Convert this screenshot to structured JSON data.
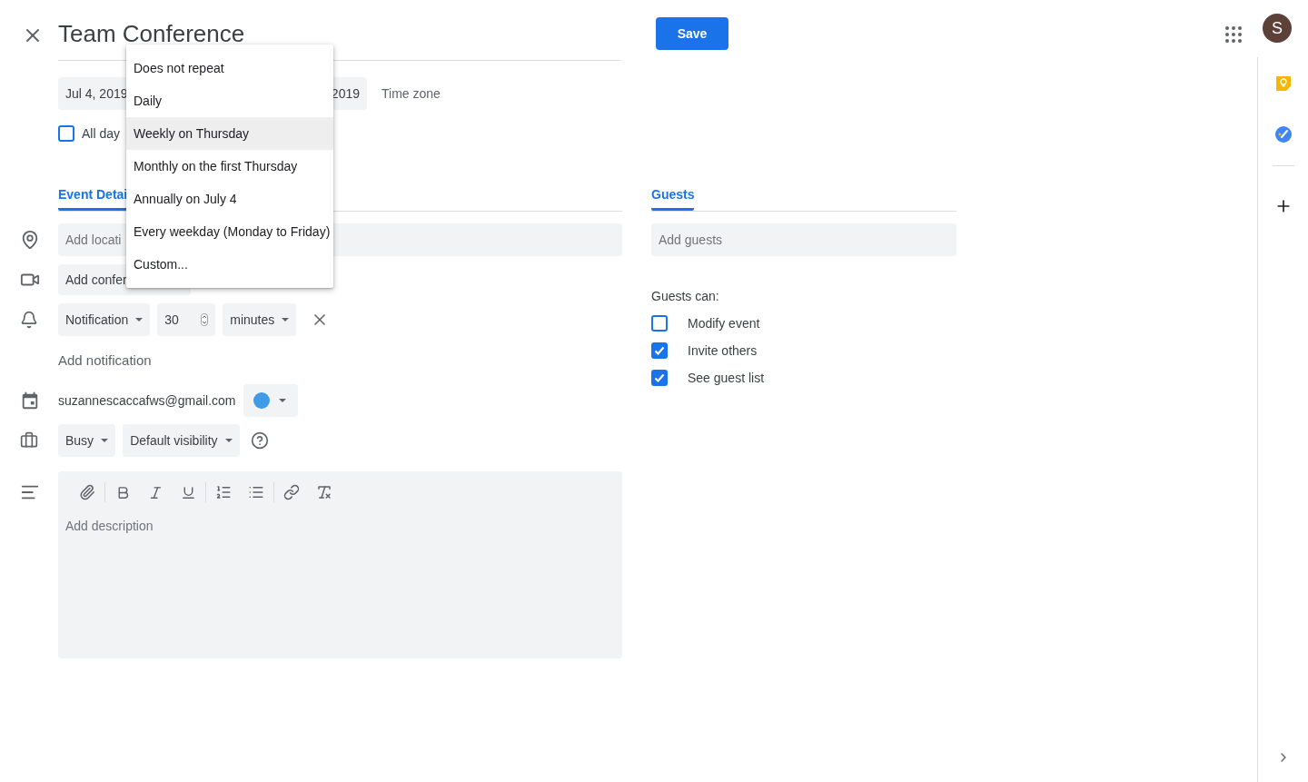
{
  "title": "Team Conference",
  "save_button": "Save",
  "avatar": "S",
  "date_row": {
    "start": "Jul 4, 2019",
    "end": "2019",
    "time_zone": "Time zone"
  },
  "all_day": {
    "label": "All day",
    "checked": false
  },
  "repeat_menu": [
    {
      "label": "Does not repeat",
      "selected": false
    },
    {
      "label": "Daily",
      "selected": false
    },
    {
      "label": "Weekly on Thursday",
      "selected": true
    },
    {
      "label": "Monthly on the first Thursday",
      "selected": false
    },
    {
      "label": "Annually on July 4",
      "selected": false
    },
    {
      "label": "Every weekday (Monday to Friday)",
      "selected": false
    },
    {
      "label": "Custom...",
      "selected": false
    }
  ],
  "details_tab": {
    "label": "Event Detai",
    "selected": true
  },
  "location": {
    "placeholder": "Add locati"
  },
  "conference": "Add confer",
  "notification": {
    "type": "Notification",
    "amount": "30",
    "unit": "minutes"
  },
  "add_notification": "Add notification",
  "calendar": {
    "account": "suzannescaccafws@gmail.com"
  },
  "availability": "Busy",
  "visibility": "Default visibility",
  "description": {
    "placeholder": "Add description"
  },
  "guests_tab": {
    "label": "Guests",
    "selected": true
  },
  "add_guests": {
    "placeholder": "Add guests"
  },
  "guests_can": "Guests can:",
  "permissions": [
    {
      "label": "Modify event",
      "checked": false
    },
    {
      "label": "Invite others",
      "checked": true
    },
    {
      "label": "See guest list",
      "checked": true
    }
  ]
}
